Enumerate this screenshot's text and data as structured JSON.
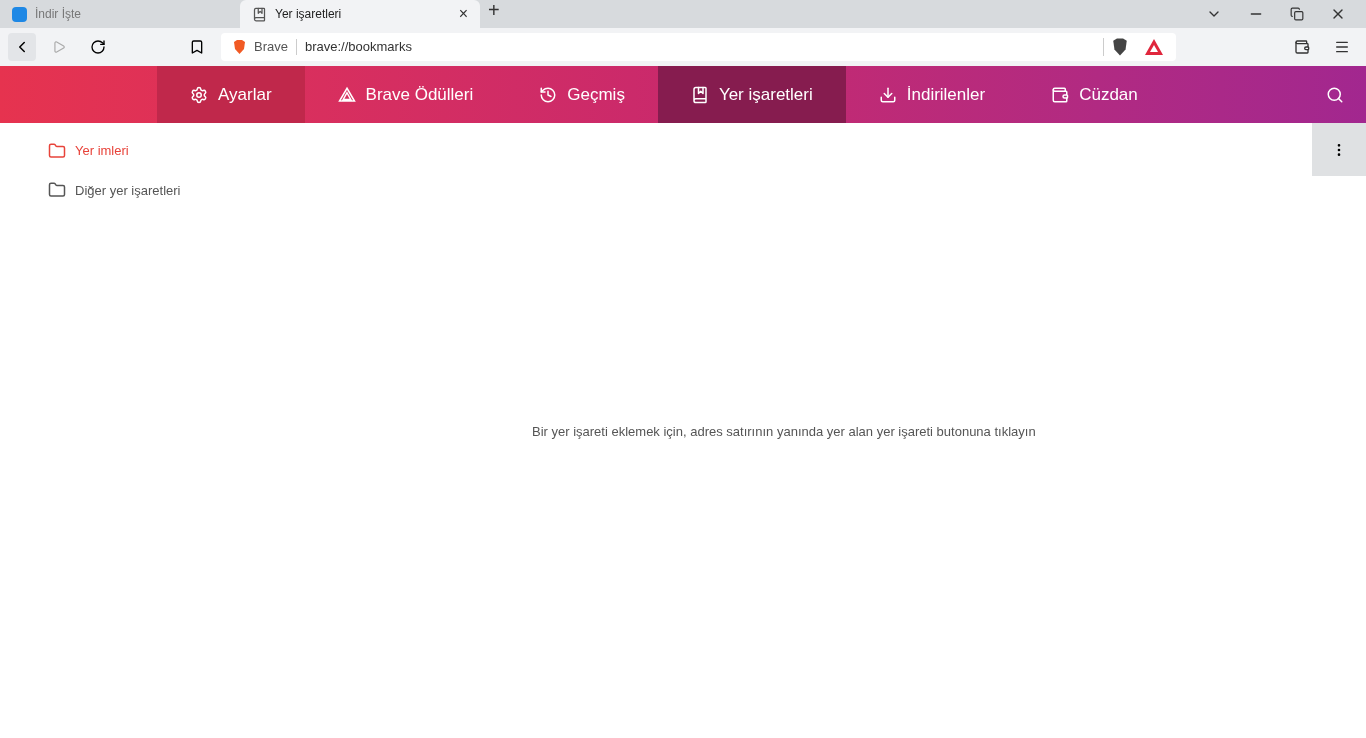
{
  "browser_tabs": [
    {
      "title": "İndir İşte",
      "selected": false
    },
    {
      "title": "Yer işaretleri",
      "selected": true,
      "close": "×"
    }
  ],
  "new_tab": "+",
  "address_bar": {
    "site": "Brave",
    "url": "brave://bookmarks"
  },
  "nav": [
    {
      "label": "Ayarlar",
      "kind": "gear",
      "selected": false,
      "hovered": true
    },
    {
      "label": "Brave Ödülleri",
      "kind": "triangle",
      "selected": false,
      "hovered": false
    },
    {
      "label": "Geçmiş",
      "kind": "history",
      "selected": false,
      "hovered": false
    },
    {
      "label": "Yer işaretleri",
      "kind": "bookmark",
      "selected": true,
      "hovered": false
    },
    {
      "label": "İndirilenler",
      "kind": "download",
      "selected": false,
      "hovered": false
    },
    {
      "label": "Cüzdan",
      "kind": "wallet",
      "selected": false,
      "hovered": false
    }
  ],
  "folders": [
    {
      "label": "Yer imleri",
      "selected": true
    },
    {
      "label": "Diğer yer işaretleri",
      "selected": false
    }
  ],
  "empty_message": "Bir yer işareti eklemek için, adres satırının yanında yer alan yer işareti butonuna tıklayın"
}
